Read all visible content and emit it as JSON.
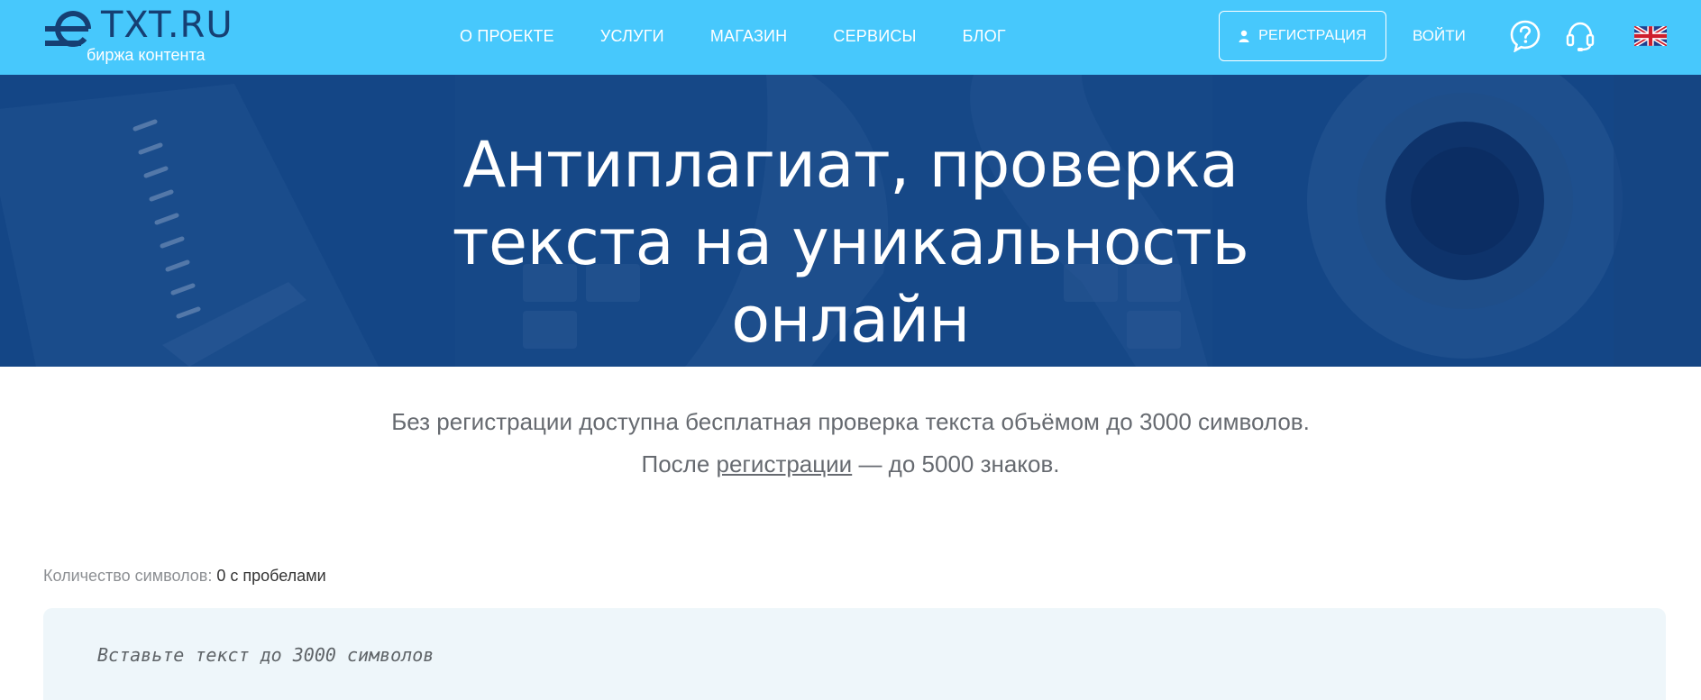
{
  "header": {
    "logo": {
      "title": "TXT.RU",
      "subtitle": "биржа контента"
    },
    "nav": [
      {
        "label": "О ПРОЕКТЕ"
      },
      {
        "label": "УСЛУГИ"
      },
      {
        "label": "МАГАЗИН"
      },
      {
        "label": "СЕРВИСЫ"
      },
      {
        "label": "БЛОГ"
      }
    ],
    "register_label": "РЕГИСТРАЦИЯ",
    "login_label": "ВОЙТИ",
    "icons": {
      "help": "help-icon",
      "support": "headset-icon",
      "language": "uk-flag-icon"
    }
  },
  "hero": {
    "title_lines": [
      "Антиплагиат, проверка",
      "текста на уникальность",
      "онлайн"
    ]
  },
  "intro": {
    "line1": "Без регистрации доступна бесплатная проверка текста объёмом до 3000 символов.",
    "line2_before": "После ",
    "line2_link": "регистрации",
    "line2_after": " — до 5000 знаков."
  },
  "counter": {
    "label": "Количество символов:",
    "value": "0 с пробелами"
  },
  "editor": {
    "placeholder": "Вставьте текст до 3000 символов",
    "value": ""
  },
  "colors": {
    "header_bg": "#47c8fc",
    "hero_bg": "#184c8d",
    "logo_dark": "#163f73",
    "editor_bg": "#eef6fa"
  }
}
